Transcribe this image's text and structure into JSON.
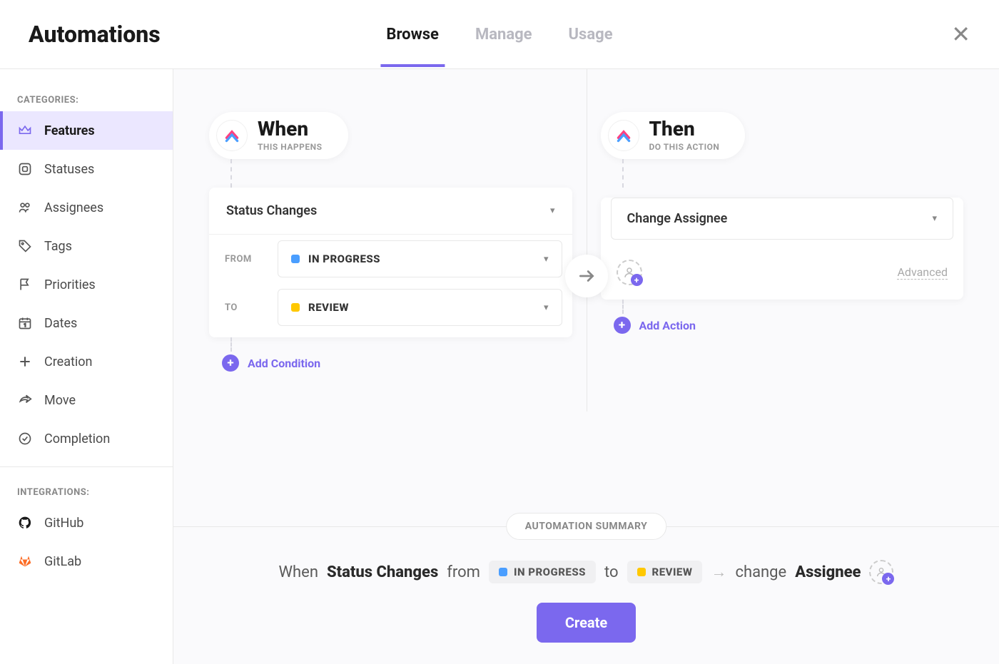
{
  "header": {
    "title": "Automations",
    "tabs": [
      "Browse",
      "Manage",
      "Usage"
    ],
    "activeTab": 0
  },
  "sidebar": {
    "categoriesLabel": "CATEGORIES:",
    "categories": [
      {
        "label": "Features",
        "active": true,
        "icon": "crown"
      },
      {
        "label": "Statuses",
        "icon": "status"
      },
      {
        "label": "Assignees",
        "icon": "people"
      },
      {
        "label": "Tags",
        "icon": "tag"
      },
      {
        "label": "Priorities",
        "icon": "flag"
      },
      {
        "label": "Dates",
        "icon": "calendar"
      },
      {
        "label": "Creation",
        "icon": "plus"
      },
      {
        "label": "Move",
        "icon": "share"
      },
      {
        "label": "Completion",
        "icon": "check"
      }
    ],
    "integrationsLabel": "INTEGRATIONS:",
    "integrations": [
      {
        "label": "GitHub",
        "icon": "github"
      },
      {
        "label": "GitLab",
        "icon": "gitlab"
      }
    ]
  },
  "when": {
    "title": "When",
    "subtitle": "THIS HAPPENS",
    "trigger": "Status Changes",
    "fromLabel": "FROM",
    "fromStatus": "IN PROGRESS",
    "toLabel": "TO",
    "toStatus": "REVIEW",
    "addCondition": "Add Condition"
  },
  "then": {
    "title": "Then",
    "subtitle": "DO THIS ACTION",
    "action": "Change Assignee",
    "advanced": "Advanced",
    "addAction": "Add Action"
  },
  "summary": {
    "label": "AUTOMATION SUMMARY",
    "whenWord": "When",
    "trigger": "Status Changes",
    "fromWord": "from",
    "fromStatus": "IN PROGRESS",
    "toWord": "to",
    "toStatus": "REVIEW",
    "changeWord": "change",
    "target": "Assignee",
    "createBtn": "Create"
  }
}
